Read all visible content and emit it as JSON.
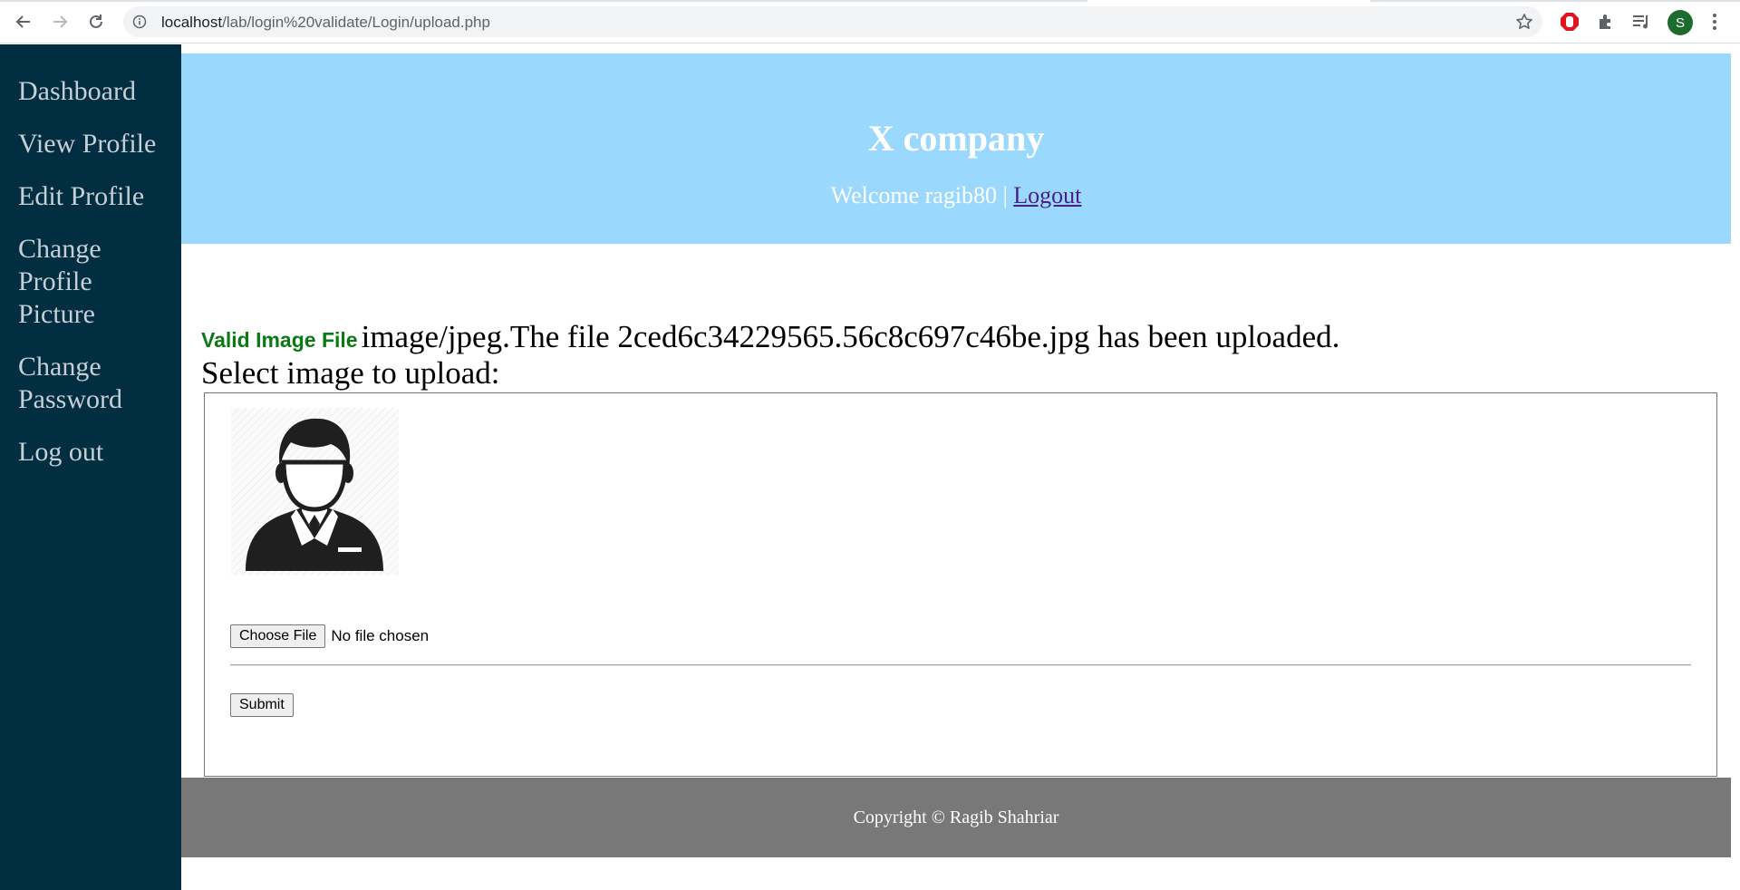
{
  "browser": {
    "url_host": "localhost",
    "url_path": "/lab/login%20validate/Login/upload.php",
    "profile_initial": "S"
  },
  "sidebar": {
    "items": [
      {
        "label": "Dashboard"
      },
      {
        "label": "View Profile"
      },
      {
        "label": "Edit Profile"
      },
      {
        "label": "Change Profile Picture"
      },
      {
        "label": "Change Password"
      },
      {
        "label": "Log out"
      }
    ]
  },
  "header": {
    "company": "X company",
    "welcome": "Welcome ragib80",
    "separator": "|",
    "logout": "Logout"
  },
  "main": {
    "valid_label": "Valid Image File",
    "upload_message": "image/jpeg.The file 2ced6c34229565.56c8c697c46be.jpg has been uploaded.",
    "select_label": "Select image to upload:",
    "choose_file": "Choose File",
    "no_file": "No file chosen",
    "submit": "Submit"
  },
  "footer": {
    "copyright": "Copyright © Ragib Shahriar"
  },
  "colors": {
    "sidebar_bg": "#012e40",
    "header_bg": "#9ad8fd",
    "footer_bg": "#787878",
    "valid_green": "#0b7a14",
    "logout_link": "#4b1d8b"
  }
}
